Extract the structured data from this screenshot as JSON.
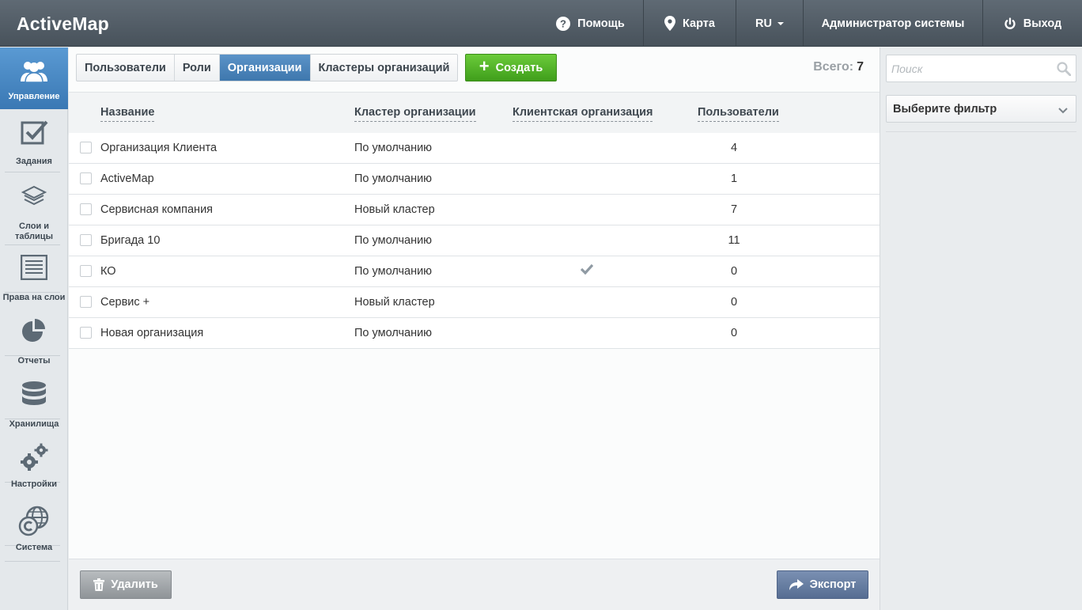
{
  "app": {
    "title": "ActiveMap"
  },
  "topnav": {
    "help": "Помощь",
    "map": "Карта",
    "lang": "RU",
    "user": "Администратор системы",
    "logout": "Выход"
  },
  "sidebar": {
    "items": [
      {
        "label": "Управление",
        "icon": "users-icon",
        "active": true
      },
      {
        "label": "Задания",
        "icon": "checkbox-icon"
      },
      {
        "label": "Слои и таблицы",
        "icon": "layers-icon"
      },
      {
        "label": "Права на слои",
        "icon": "list-icon"
      },
      {
        "label": "Отчеты",
        "icon": "pie-chart-icon"
      },
      {
        "label": "Хранилища",
        "icon": "database-icon"
      },
      {
        "label": "Настройки",
        "icon": "gears-icon"
      },
      {
        "label": "Система",
        "icon": "globe-copyright-icon"
      }
    ]
  },
  "tabs": [
    {
      "label": "Пользователи"
    },
    {
      "label": "Роли"
    },
    {
      "label": "Организации",
      "active": true
    },
    {
      "label": "Кластеры организаций"
    }
  ],
  "toolbar": {
    "create_label": "Создать",
    "total_label": "Всего:",
    "total_value": "7"
  },
  "table": {
    "columns": {
      "name": "Название",
      "cluster": "Кластер организации",
      "client": "Клиентская организация",
      "users": "Пользователи"
    },
    "rows": [
      {
        "name": "Организация Клиента",
        "cluster": "По умолчанию",
        "client": false,
        "users": "4"
      },
      {
        "name": "ActiveMap",
        "cluster": "По умолчанию",
        "client": false,
        "users": "1"
      },
      {
        "name": "Сервисная компания",
        "cluster": "Новый кластер",
        "client": false,
        "users": "7"
      },
      {
        "name": "Бригада 10",
        "cluster": "По умолчанию",
        "client": false,
        "users": "11"
      },
      {
        "name": "КО",
        "cluster": "По умолчанию",
        "client": true,
        "users": "0"
      },
      {
        "name": "Сервис +",
        "cluster": "Новый кластер",
        "client": false,
        "users": "0"
      },
      {
        "name": "Новая организация",
        "cluster": "По умолчанию",
        "client": false,
        "users": "0"
      }
    ]
  },
  "footer": {
    "delete_label": "Удалить",
    "export_label": "Экспорт"
  },
  "rightpanel": {
    "search_placeholder": "Поиск",
    "filter_label": "Выберите фильтр"
  },
  "colors": {
    "accent": "#3e77ad",
    "create": "#4fae25",
    "topbar": "#515b64"
  }
}
